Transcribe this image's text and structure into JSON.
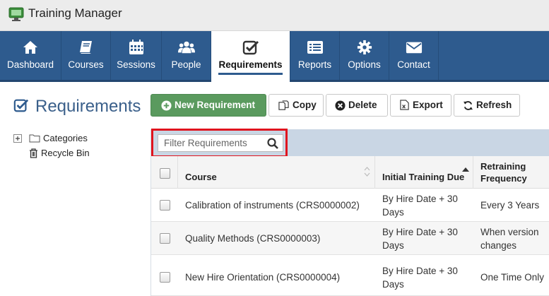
{
  "app": {
    "title": "Training Manager"
  },
  "nav": {
    "items": [
      {
        "label": "Dashboard",
        "icon": "home-icon"
      },
      {
        "label": "Courses",
        "icon": "book-icon"
      },
      {
        "label": "Sessions",
        "icon": "calendar-icon"
      },
      {
        "label": "People",
        "icon": "users-icon"
      },
      {
        "label": "Requirements",
        "icon": "checkbox-icon",
        "active": true
      },
      {
        "label": "Reports",
        "icon": "list-icon"
      },
      {
        "label": "Options",
        "icon": "gear-icon"
      },
      {
        "label": "Contact",
        "icon": "envelope-icon"
      }
    ]
  },
  "page": {
    "title": "Requirements"
  },
  "tree": {
    "categories": "Categories",
    "recycle_bin": "Recycle Bin"
  },
  "toolbar": {
    "new_label": "New Requirement",
    "copy_label": "Copy",
    "delete_label": "Delete",
    "export_label": "Export",
    "refresh_label": "Refresh"
  },
  "filter": {
    "placeholder": "Filter Requirements"
  },
  "table": {
    "columns": [
      "Course",
      "Initial Training Due",
      "Retraining Frequency"
    ],
    "rows": [
      {
        "course": "Calibration of instruments (CRS0000002)",
        "due": "By Hire Date + 30 Days",
        "freq": "Every 3 Years"
      },
      {
        "course": "Quality Methods (CRS0000003)",
        "due": "By Hire Date + 30 Days",
        "freq": "When version changes"
      },
      {
        "course": "New Hire Orientation (CRS0000004)",
        "due": "By Hire Date + 30 Days",
        "freq": "One Time Only"
      }
    ]
  },
  "colors": {
    "nav_bg": "#2e5b8e",
    "primary_btn": "#5a9a5e",
    "highlight": "#e0141e",
    "title": "#3a5f8a"
  }
}
